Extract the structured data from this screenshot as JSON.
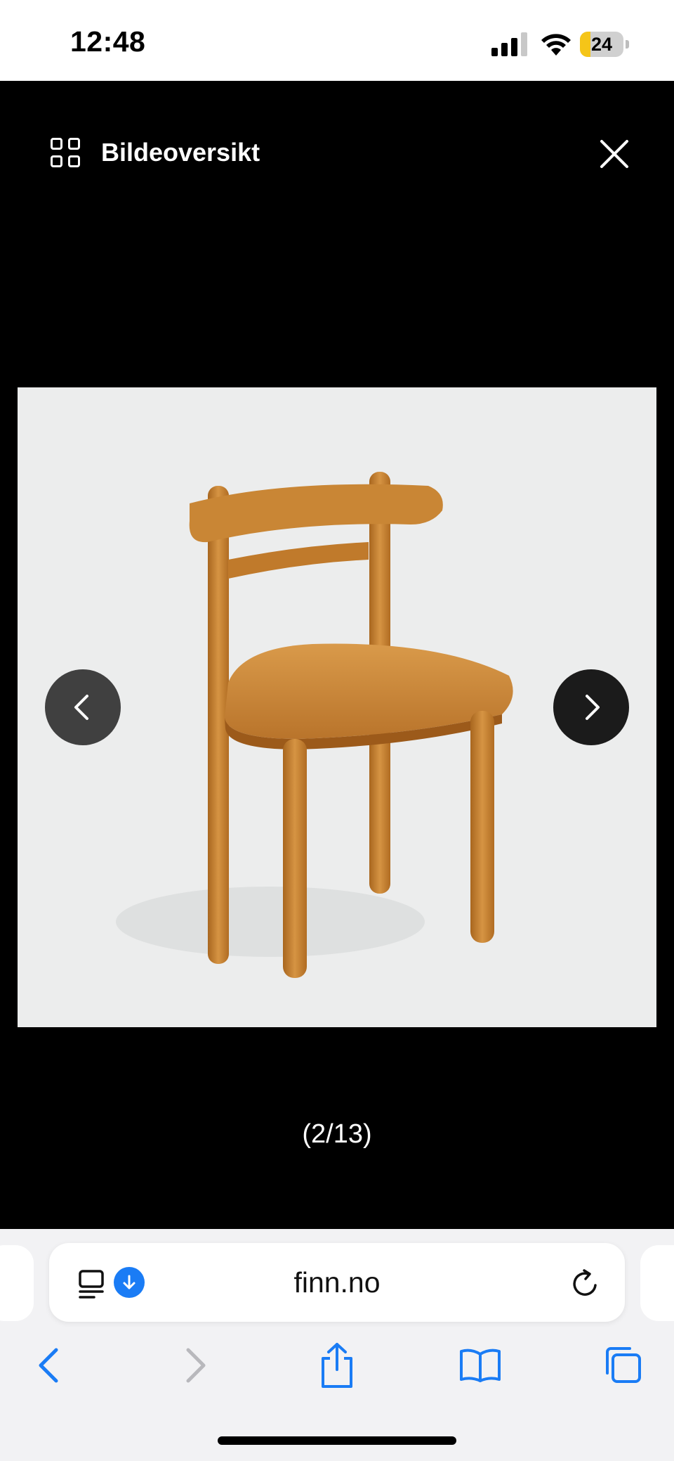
{
  "status_bar": {
    "time": "12:48",
    "battery_level": "24",
    "battery_fraction": 0.24,
    "icons": [
      "cellular-signal-icon",
      "wifi-icon",
      "battery-icon"
    ]
  },
  "gallery": {
    "overview_label": "Bildeoversikt",
    "counter": "(2/13)",
    "icons": [
      "grid-icon",
      "close-icon",
      "chevron-left-icon",
      "chevron-right-icon"
    ]
  },
  "browser": {
    "url": "finn.no",
    "icons": [
      "reader-icon",
      "download-icon",
      "reload-icon",
      "back-icon",
      "forward-icon",
      "share-icon",
      "bookmarks-icon",
      "tabs-icon"
    ]
  },
  "colors": {
    "background": "#000000",
    "accent": "#1a7cf5",
    "battery": "#f5c518",
    "photo_background": "#eceded",
    "wood": "#c8832f"
  }
}
